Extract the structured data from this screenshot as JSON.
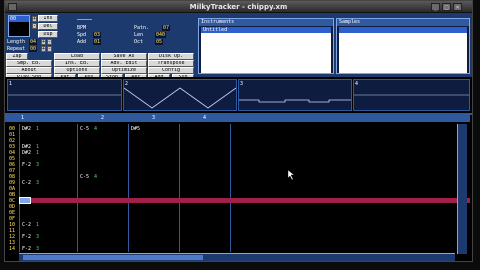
{
  "window": {
    "title": "MilkyTracker - chippy.xm"
  },
  "panel": {
    "song": {
      "position_label": "Pos",
      "pattern_label": "Patn.",
      "length_label": "Length",
      "repeat_label": "Repeat",
      "length_value": "04",
      "repeat_value": "00",
      "pattern_value": "07",
      "bpm_label": "BPM",
      "spd_label": "Spd",
      "add_label": "Add",
      "oct_label": "Oct",
      "len_label": "Len",
      "spd_value": "03",
      "add_value": "01",
      "len_value": "040",
      "oct_value": "05",
      "order_current": "00"
    },
    "buttons": [
      [
        "Zap",
        "Load",
        "Save As",
        "Disk Op."
      ],
      [
        "Smp. Ed.",
        "Ins. Ed.",
        "Adv. Edit",
        "Transpose"
      ],
      [
        "About",
        "Options",
        "Optimize",
        "Config"
      ],
      [
        "Play Sng",
        "Pat",
        "Pos",
        "Stop",
        "Rec",
        "Add",
        "Sub"
      ]
    ],
    "instruments": {
      "header": "Instruments",
      "selected": "Untitled"
    },
    "samples": {
      "header": "Samples"
    }
  },
  "scope": {
    "channels": [
      "1",
      "2",
      "3",
      "4"
    ]
  },
  "pattern": {
    "channels": [
      "1",
      "2",
      "3",
      "4"
    ],
    "rows": [
      "00",
      "01",
      "02",
      "03",
      "04",
      "05",
      "06",
      "07",
      "08",
      "09",
      "0A",
      "0B",
      "0C",
      "0D",
      "0E",
      "0F",
      "10",
      "11",
      "12",
      "13",
      "14"
    ],
    "cells": [
      {
        "ch": 0,
        "row": 0,
        "note": "D#2",
        "ins": "1"
      },
      {
        "ch": 0,
        "row": 3,
        "note": "D#2",
        "ins": "1"
      },
      {
        "ch": 0,
        "row": 4,
        "note": "D#2",
        "ins": "1"
      },
      {
        "ch": 0,
        "row": 6,
        "note": "F-2",
        "ins": "3"
      },
      {
        "ch": 0,
        "row": 9,
        "note": "C-2",
        "ins": "3"
      },
      {
        "ch": 0,
        "row": 12,
        "note": "C-2",
        "ins": "3"
      },
      {
        "ch": 0,
        "row": 16,
        "note": "C-2",
        "ins": "1"
      },
      {
        "ch": 0,
        "row": 18,
        "note": "F-2",
        "ins": "3"
      },
      {
        "ch": 0,
        "row": 20,
        "note": "F-2",
        "ins": "3"
      },
      {
        "ch": 1,
        "row": 0,
        "note": "C-5",
        "ins": "4"
      },
      {
        "ch": 1,
        "row": 8,
        "note": "C-5",
        "ins": "4"
      },
      {
        "ch": 1,
        "row": 12,
        "note": "C-5",
        "ins": "4"
      },
      {
        "ch": 2,
        "row": 0,
        "note": "D#5",
        "ins": ""
      },
      {
        "ch": 2,
        "row": 12,
        "note": "C-5",
        "ins": ""
      }
    ]
  },
  "colors": {
    "panel": "#1d3a6e",
    "accent": "#2f5aa0",
    "cursor_row": "#a0204a",
    "instrument_select": "#2c5fd0"
  }
}
